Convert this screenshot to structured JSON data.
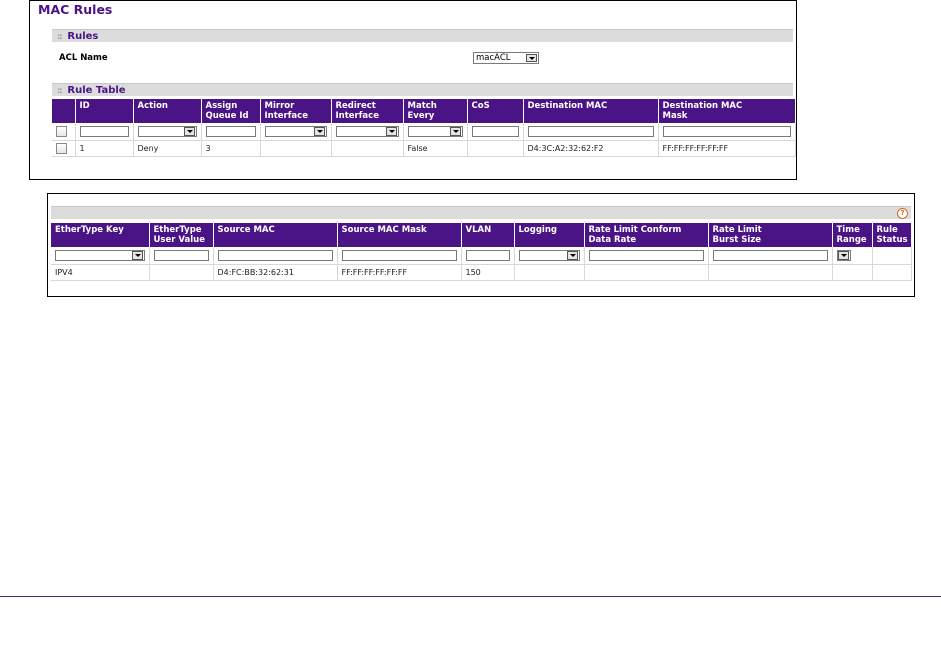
{
  "page": {
    "title": "MAC Rules"
  },
  "rules_section": {
    "header": "Rules",
    "acl_name_label": "ACL Name",
    "acl_name_value": "macACL"
  },
  "rule_table": {
    "header": "Rule Table",
    "columns": [
      "",
      "ID",
      "Action",
      "Assign Queue Id",
      "Mirror Interface",
      "Redirect Interface",
      "Match Every",
      "CoS",
      "Destination MAC",
      "Destination MAC Mask"
    ],
    "column_lines": [
      [
        "",
        ""
      ],
      [
        "ID",
        ""
      ],
      [
        "Action",
        ""
      ],
      [
        "Assign",
        "Queue Id"
      ],
      [
        "Mirror",
        "Interface"
      ],
      [
        "Redirect",
        "Interface"
      ],
      [
        "Match",
        "Every"
      ],
      [
        "CoS",
        ""
      ],
      [
        "Destination MAC",
        ""
      ],
      [
        "Destination MAC",
        "Mask"
      ]
    ],
    "row": {
      "id": "1",
      "action": "Deny",
      "assign_queue_id": "3",
      "mirror_interface": "",
      "redirect_interface": "",
      "match_every": "False",
      "cos": "",
      "destination_mac": "D4:3C:A2:32:62:F2",
      "destination_mac_mask": "FF:FF:FF:FF:FF:FF"
    }
  },
  "extended_table": {
    "column_lines": [
      [
        "EtherType Key",
        ""
      ],
      [
        "EtherType",
        "User Value"
      ],
      [
        "Source MAC",
        ""
      ],
      [
        "Source MAC Mask",
        ""
      ],
      [
        "VLAN",
        ""
      ],
      [
        "Logging",
        ""
      ],
      [
        "Rate Limit Conform",
        "Data Rate"
      ],
      [
        "Rate Limit",
        "Burst Size"
      ],
      [
        "Time",
        "Range"
      ],
      [
        "Rule",
        "Status"
      ]
    ],
    "row": {
      "ethertype_key": "IPV4",
      "ethertype_user_value": "",
      "source_mac": "D4:FC:BB:32:62:31",
      "source_mac_mask": "FF:FF:FF:FF:FF:FF",
      "vlan": "150",
      "logging": "",
      "rate_limit_conform": "",
      "rate_limit_burst": "",
      "time_range": "",
      "rule_status": ""
    },
    "help_icon": "help-icon"
  },
  "colors": {
    "header_purple": "#4a1486",
    "section_gray": "#dcdcdc",
    "help_orange": "#e0652b"
  }
}
